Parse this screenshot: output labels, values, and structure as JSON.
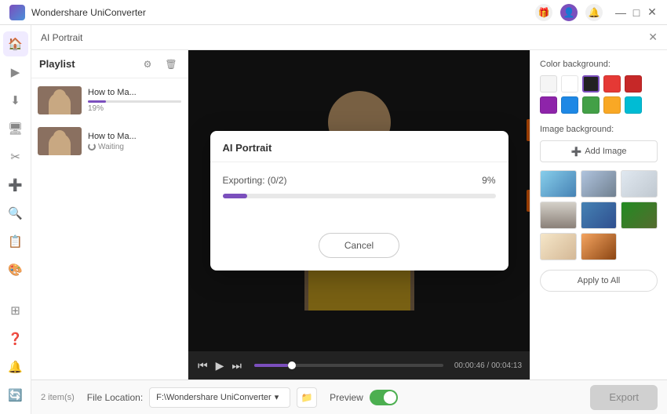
{
  "app": {
    "title": "Wondershare UniConverter",
    "logo_alt": "UniConverter Logo"
  },
  "titlebar": {
    "minimize": "—",
    "maximize": "□",
    "close": "✕"
  },
  "panel": {
    "title": "AI Portrait",
    "close_btn": "✕"
  },
  "playlist": {
    "title": "Playlist",
    "items": [
      {
        "name": "How to Ma...",
        "progress": 19,
        "status": "percent",
        "percent_label": "19%"
      },
      {
        "name": "How to Ma...",
        "progress": 0,
        "status": "waiting",
        "status_label": "Waiting"
      }
    ],
    "count_label": "2 item(s)"
  },
  "video": {
    "time_current": "00:00:46",
    "time_total": "00:04:13",
    "time_display": "00:00:46 / 00:04:13"
  },
  "color_panel": {
    "bg_section_title": "Color background:",
    "img_section_title": "Image background:",
    "add_image_btn": "Add Image",
    "apply_all_btn": "Apply to All",
    "swatches": [
      {
        "color": "#f5f5f5",
        "active": false
      },
      {
        "color": "#ffffff",
        "active": false
      },
      {
        "color": "#222222",
        "active": true
      },
      {
        "color": "#e53935",
        "active": false
      },
      {
        "color": "#c62828",
        "active": false
      },
      {
        "color": "#8e24aa",
        "active": false
      },
      {
        "color": "#1e88e5",
        "active": false
      },
      {
        "color": "#43a047",
        "active": false
      },
      {
        "color": "#f9a825",
        "active": false
      },
      {
        "color": "#00bcd4",
        "active": false
      }
    ]
  },
  "modal": {
    "title": "AI Portrait",
    "status_text": "Exporting: (0/2)",
    "percent": "9%",
    "progress_value": 9,
    "cancel_btn": "Cancel"
  },
  "bottom_bar": {
    "file_location_label": "File Location:",
    "file_path": "F:\\Wondershare UniConverter",
    "preview_label": "Preview",
    "export_btn": "Export"
  },
  "nav": {
    "items": [
      "🏠",
      "▶",
      "⬇",
      "🖥",
      "✂",
      "➕",
      "🔍",
      "📋",
      "🎨",
      "⊞"
    ]
  }
}
